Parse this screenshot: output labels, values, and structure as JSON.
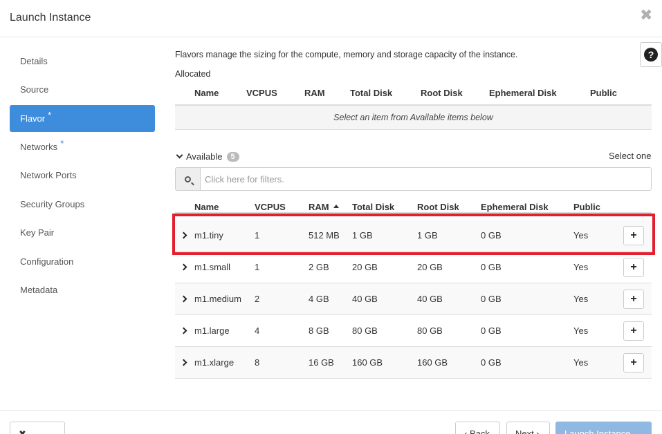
{
  "modal": {
    "title": "Launch Instance",
    "close_glyph": "✖"
  },
  "sidebar": {
    "items": [
      {
        "label": "Details",
        "required": ""
      },
      {
        "label": "Source",
        "required": ""
      },
      {
        "label": "Flavor",
        "required": "*",
        "active": true
      },
      {
        "label": "Networks",
        "required": "*"
      },
      {
        "label": "Network Ports",
        "required": ""
      },
      {
        "label": "Security Groups",
        "required": ""
      },
      {
        "label": "Key Pair",
        "required": ""
      },
      {
        "label": "Configuration",
        "required": ""
      },
      {
        "label": "Metadata",
        "required": ""
      }
    ]
  },
  "help": {
    "label": "?"
  },
  "content": {
    "description": "Flavors manage the sizing for the compute, memory and storage capacity of the instance.",
    "allocated": {
      "label": "Allocated",
      "columns": [
        "Name",
        "VCPUS",
        "RAM",
        "Total Disk",
        "Root Disk",
        "Ephemeral Disk",
        "Public"
      ],
      "empty_message": "Select an item from Available items below"
    },
    "available": {
      "label": "Available",
      "count": "5",
      "select_one": "Select one",
      "search_placeholder": "Click here for filters.",
      "columns": [
        "Name",
        "VCPUS",
        "RAM",
        "Total Disk",
        "Root Disk",
        "Ephemeral Disk",
        "Public"
      ],
      "sorted_column": "RAM",
      "rows": [
        {
          "name": "m1.tiny",
          "vcpus": "1",
          "ram": "512 MB",
          "total_disk": "1 GB",
          "root_disk": "1 GB",
          "ephemeral_disk": "0 GB",
          "public": "Yes",
          "add": "+"
        },
        {
          "name": "m1.small",
          "vcpus": "1",
          "ram": "2 GB",
          "total_disk": "20 GB",
          "root_disk": "20 GB",
          "ephemeral_disk": "0 GB",
          "public": "Yes",
          "add": "+"
        },
        {
          "name": "m1.medium",
          "vcpus": "2",
          "ram": "4 GB",
          "total_disk": "40 GB",
          "root_disk": "40 GB",
          "ephemeral_disk": "0 GB",
          "public": "Yes",
          "add": "+"
        },
        {
          "name": "m1.large",
          "vcpus": "4",
          "ram": "8 GB",
          "total_disk": "80 GB",
          "root_disk": "80 GB",
          "ephemeral_disk": "0 GB",
          "public": "Yes",
          "add": "+"
        },
        {
          "name": "m1.xlarge",
          "vcpus": "8",
          "ram": "16 GB",
          "total_disk": "160 GB",
          "root_disk": "160 GB",
          "ephemeral_disk": "0 GB",
          "public": "Yes",
          "add": "+"
        }
      ]
    }
  },
  "footer": {
    "cancel_label": "✖ Cancel",
    "back_label": "‹ Back",
    "next_label": "Next ›",
    "launch_label": "Launch Instance"
  },
  "colors": {
    "accent": "#3e8ddd",
    "highlight": "#e0202e",
    "launch_disabled": "#8fb9e3"
  }
}
